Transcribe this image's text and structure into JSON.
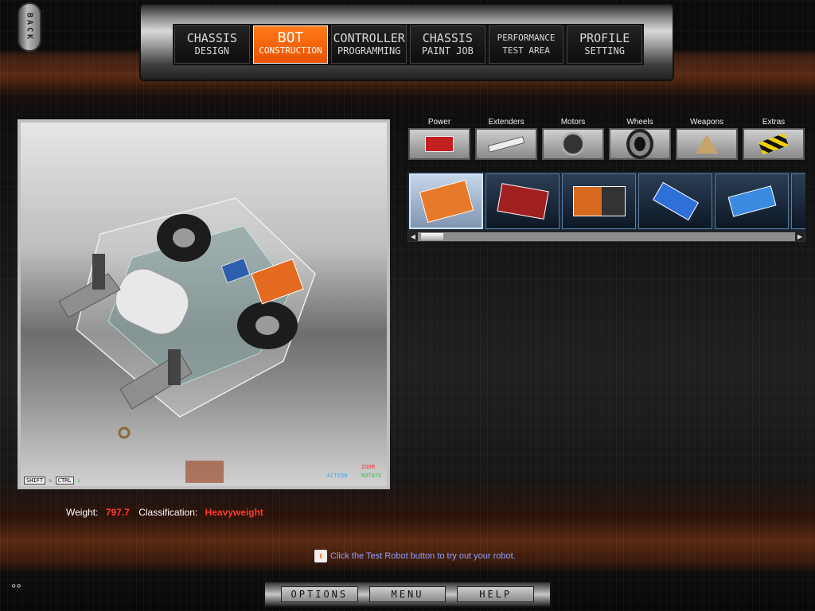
{
  "back_label": "BACK",
  "nav": {
    "tabs": [
      {
        "line1": "CHASSIS",
        "line2": "DESIGN",
        "active": false
      },
      {
        "line1": "BOT",
        "line2": "CONSTRUCTION",
        "active": true
      },
      {
        "line1": "CONTROLLER",
        "line2": "PROGRAMMING",
        "active": false
      },
      {
        "line1": "CHASSIS",
        "line2": "PAINT JOB",
        "active": false
      },
      {
        "line1": "PERFORMANCE",
        "line2": "TEST AREA",
        "active": false
      },
      {
        "line1": "PROFILE",
        "line2": "SETTING",
        "active": false
      }
    ]
  },
  "viewport": {
    "shift_key": "SHIFT",
    "ctrl_key": "CTRL",
    "action_label": "ACTION",
    "zoom_label": "ZOOM",
    "rotate_label": "ROTATE"
  },
  "stats": {
    "weight_label": "Weight:",
    "weight_value": "797.7",
    "classification_label": "Classification:",
    "classification_value": "Heavyweight"
  },
  "categories": [
    {
      "label": "Power",
      "icon": "battery-icon"
    },
    {
      "label": "Extenders",
      "icon": "extender-bar-icon"
    },
    {
      "label": "Motors",
      "icon": "motor-icon"
    },
    {
      "label": "Wheels",
      "icon": "wheel-icon"
    },
    {
      "label": "Weapons",
      "icon": "weapon-blade-icon"
    },
    {
      "label": "Extras",
      "icon": "extras-hazard-icon"
    }
  ],
  "parts": [
    {
      "name": "orange-battery",
      "color": "#e77a2a",
      "selected": true
    },
    {
      "name": "red-battery",
      "color": "#a02020",
      "selected": false
    },
    {
      "name": "battery-pack",
      "color": "#d86a1f",
      "selected": false
    },
    {
      "name": "blue-battery",
      "color": "#2f6fd8",
      "selected": false
    },
    {
      "name": "blue-cell",
      "color": "#3a8ae0",
      "selected": false
    }
  ],
  "tip": {
    "text": "Click the Test Robot button to try out your robot."
  },
  "bottom_nav": {
    "options": "OPTIONS",
    "menu": "MENU",
    "help": "HELP"
  },
  "colors": {
    "active_tab": "#e95200",
    "warning_value": "#ff3b2f",
    "tip_text": "#8fa0ff"
  }
}
